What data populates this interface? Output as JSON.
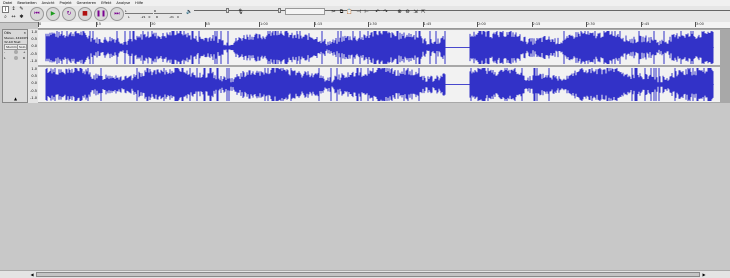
{
  "menu": [
    "Datei",
    "Bearbeiten",
    "Ansicht",
    "Projekt",
    "Generieren",
    "Effekt",
    "Analyse",
    "Hilfe"
  ],
  "tools": [
    {
      "icon": "selection-tool-icon",
      "glyph": "I",
      "active": true
    },
    {
      "icon": "envelope-tool-icon",
      "glyph": "↕",
      "active": false
    },
    {
      "icon": "draw-tool-icon",
      "glyph": "✎",
      "active": false
    },
    {
      "icon": "zoom-tool-icon",
      "glyph": "⌕",
      "active": false
    },
    {
      "icon": "timeshift-tool-icon",
      "glyph": "↔",
      "active": false
    },
    {
      "icon": "multi-tool-icon",
      "glyph": "✱",
      "active": false
    }
  ],
  "transport": [
    {
      "icon": "skip-start-icon",
      "glyph": "⏮",
      "color": "#7a0090"
    },
    {
      "icon": "play-icon",
      "glyph": "▶",
      "color": "#1d9c1d"
    },
    {
      "icon": "loop-icon",
      "glyph": "↻",
      "color": "#7a0090"
    },
    {
      "icon": "stop-icon",
      "glyph": "■",
      "color": "#b01010"
    },
    {
      "icon": "pause-icon",
      "glyph": "❚❚",
      "color": "#7a0090"
    },
    {
      "icon": "skip-end-icon",
      "glyph": "⏭",
      "color": "#7a0090"
    }
  ],
  "meters": {
    "left": "L",
    "right": "R",
    "play_db": "-21",
    "rec_db": "-21",
    "zero": "0"
  },
  "ruler": {
    "start": "0",
    "ticks": [
      "15",
      "30",
      "45",
      "1:00",
      "1:15",
      "1:30",
      "1:45",
      "2:00",
      "2:15",
      "2:30",
      "2:45",
      "3:00"
    ]
  },
  "track": {
    "name": "Otis",
    "info1": "Stereo, 44100Hz",
    "info2": "32-bit float",
    "mute": "Stumm",
    "solo": "Solo",
    "minus": "-",
    "plus": "+",
    "l": "L",
    "r": "R",
    "scale": [
      "1.0",
      "0.5",
      "0.0",
      "-0.5",
      "-1.0"
    ],
    "wave_color": "#3232c8",
    "silence": [
      0.597,
      0.632
    ]
  },
  "colors": {
    "background": "#c8c8c8",
    "wave": "#3232c8"
  }
}
